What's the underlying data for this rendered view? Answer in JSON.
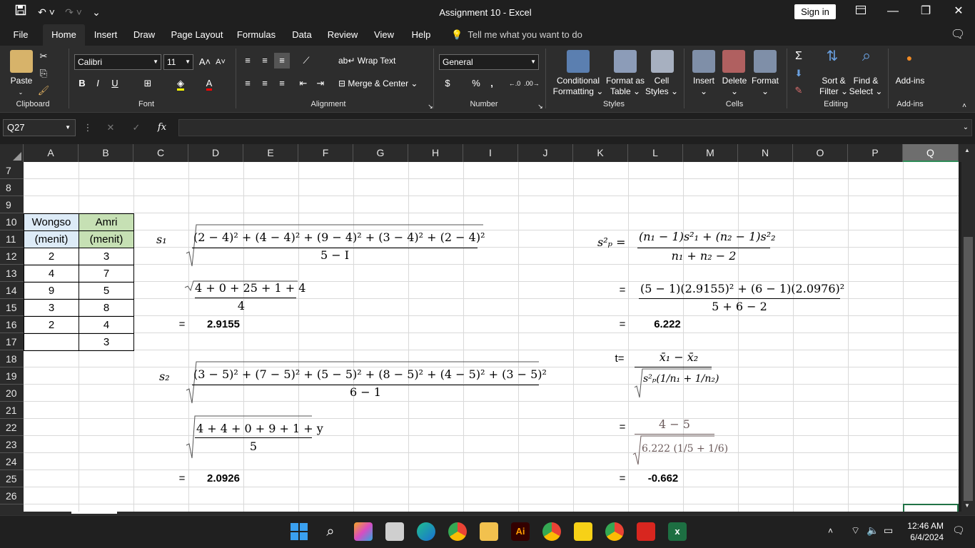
{
  "window": {
    "title": "Assignment 10  -  Excel",
    "signin": "Sign in"
  },
  "menu": {
    "tabs": [
      "File",
      "Home",
      "Insert",
      "Draw",
      "Page Layout",
      "Formulas",
      "Data",
      "Review",
      "View",
      "Help"
    ],
    "active": "Home",
    "tellme": "Tell me what you want to do"
  },
  "ribbon": {
    "clipboard": {
      "label": "Clipboard",
      "paste": "Paste"
    },
    "font": {
      "label": "Font",
      "name": "Calibri",
      "size": "11",
      "bold": "B",
      "italic": "I",
      "underline": "U"
    },
    "alignment": {
      "label": "Alignment",
      "wrap": "Wrap Text",
      "merge": "Merge & Center"
    },
    "number": {
      "label": "Number",
      "format": "General",
      "currency": "$",
      "percent": "%",
      "comma": ","
    },
    "styles": {
      "label": "Styles",
      "conditional": "Conditional",
      "conditional2": "Formatting",
      "format_as": "Format as",
      "table": "Table",
      "cell": "Cell",
      "cell_styles": "Styles"
    },
    "cells": {
      "label": "Cells",
      "insert": "Insert",
      "delete": "Delete",
      "format": "Format"
    },
    "editing": {
      "label": "Editing",
      "sort": "Sort &",
      "filter": "Filter",
      "find": "Find &",
      "select": "Select"
    },
    "addins": {
      "label": "Add-ins",
      "button": "Add-ins"
    }
  },
  "formula_bar": {
    "name_box": "Q27",
    "fx": "fx",
    "value": ""
  },
  "columns": [
    "A",
    "B",
    "C",
    "D",
    "E",
    "F",
    "G",
    "H",
    "I",
    "J",
    "K",
    "L",
    "M",
    "N",
    "O",
    "P",
    "Q"
  ],
  "selected_column": "Q",
  "rows": [
    "7",
    "8",
    "9",
    "10",
    "11",
    "12",
    "13",
    "14",
    "15",
    "16",
    "17",
    "18",
    "19",
    "20",
    "21",
    "22",
    "23",
    "24",
    "25",
    "26"
  ],
  "table": {
    "header_a": "Wongso",
    "header_b": "Amri",
    "unit_a": "(menit)",
    "unit_b": "(menit)",
    "col_a": [
      "2",
      "4",
      "9",
      "3",
      "2",
      ""
    ],
    "col_b": [
      "3",
      "7",
      "5",
      "8",
      "4",
      "3"
    ]
  },
  "math": {
    "s1_label": "s₁",
    "s1_num": "(2 − 4)² + (4 − 4)² + (9 − 4)² + (3 − 4)² + (2 − 4)²",
    "s1_den": "5 − I",
    "s1_step_num": "4 + 0 + 25 + 1 + 4",
    "s1_step_den": "4",
    "s1_result": "2.9155",
    "s2_label": "s₂",
    "s2_num": "(3 − 5)² + (7 − 5)² + (5 − 5)² + (8 − 5)² + (4 − 5)² + (3 − 5)²",
    "s2_den": "6 − 1",
    "s2_step_num": "4 + 4 + 0 + 9 + 1 + y",
    "s2_step_den": "5",
    "s2_result": "2.0926",
    "sp_label": "s²ₚ =",
    "sp_num": "(n₁ − 1)s²₁ + (n₂ − 1)s²₂",
    "sp_den": "n₁ + n₂ − 2",
    "sp_step_num": "(5 − 1)(2.9155)² + (6 − 1)(2.0976)²",
    "sp_step_den": "5 + 6 − 2",
    "sp_result": "6.222",
    "t_label": "t=",
    "t_num": "x̄₁ − x̄₂",
    "t_den": "s²ₚ(1/n₁ + 1/n₂)",
    "t_step_num": "4 − 5",
    "t_step_den": "6.222 (1/5 + 1/6)",
    "t_result": "-0.662",
    "equals": "="
  },
  "taskbar": {
    "time": "12:46 AM",
    "date": "6/4/2024"
  }
}
